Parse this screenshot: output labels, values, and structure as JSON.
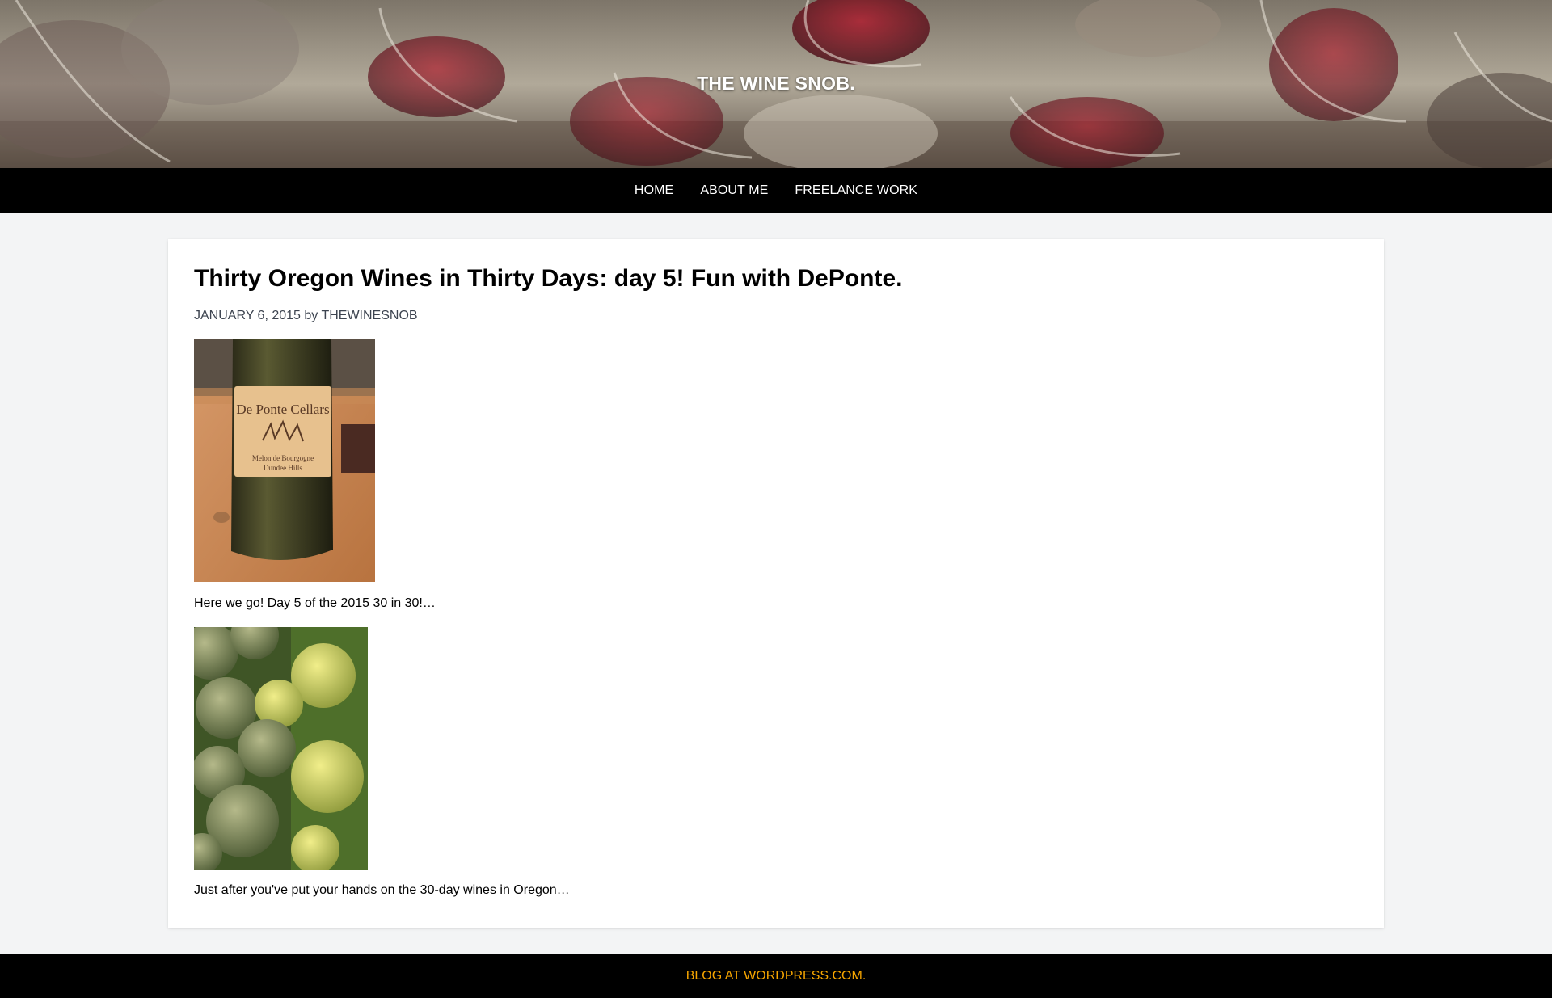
{
  "header": {
    "site_title": "THE WINE SNOB."
  },
  "nav": {
    "items": [
      {
        "label": "HOME"
      },
      {
        "label": "ABOUT ME"
      },
      {
        "label": "FREELANCE WORK"
      }
    ]
  },
  "post": {
    "title": "Thirty Oregon Wines in Thirty Days: day 5! Fun with DePonte.",
    "date": "JANUARY 6, 2015",
    "by": "by",
    "author": "THEWINESNOB",
    "image1": {
      "label_brand": "De Ponte Cellars",
      "label_line1": "Melon de Bourgogne",
      "label_line2": "Dundee Hills"
    },
    "paragraph1": "Here we go! Day 5 of the 2015 30 in 30!…",
    "paragraph2": "Just after you've put your hands on the 30-day wines in Oregon…"
  },
  "footer": {
    "link": "BLOG AT WORDPRESS.COM."
  },
  "colors": {
    "nav_bg": "#000000",
    "footer_link": "#f7a600",
    "page_bg": "#f3f4f5"
  }
}
